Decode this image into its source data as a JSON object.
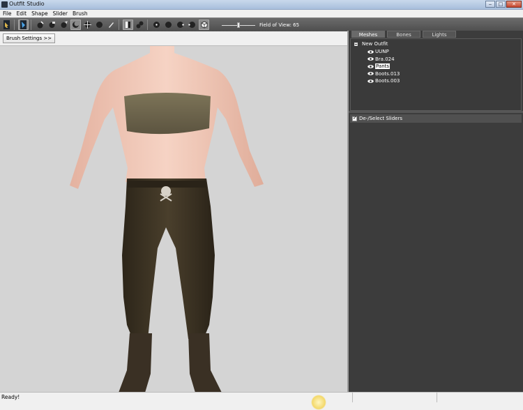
{
  "window": {
    "title": "Outfit Studio"
  },
  "menu": [
    "File",
    "Edit",
    "Shape",
    "Slider",
    "Brush"
  ],
  "toolbar": {
    "tools": [
      {
        "name": "select-tool-icon",
        "active": false
      },
      {
        "name": "mask-brush-icon",
        "active": true
      },
      {
        "name": "inflate-brush-icon",
        "active": false
      },
      {
        "name": "deflate-brush-icon",
        "active": false
      },
      {
        "name": "move-brush-icon",
        "active": false
      },
      {
        "name": "smooth-brush-icon",
        "active": true
      },
      {
        "name": "transform-icon",
        "active": false
      },
      {
        "name": "undiff-brush-icon",
        "active": false
      },
      {
        "name": "weight-brush-icon",
        "active": false
      }
    ],
    "fov_label": "Field of View: 65",
    "fov_value": 65
  },
  "brush_settings_label": "Brush Settings >>",
  "panel": {
    "tabs": [
      {
        "label": "Meshes",
        "active": true
      },
      {
        "label": "Bones",
        "active": false
      },
      {
        "label": "Lights",
        "active": false
      }
    ],
    "tree_root": "New Outfit",
    "meshes": [
      {
        "label": "UUNP",
        "selected": false
      },
      {
        "label": "Bra.024",
        "selected": false
      },
      {
        "label": "Pants",
        "selected": true
      },
      {
        "label": "Boots.013",
        "selected": false
      },
      {
        "label": "Boots.003",
        "selected": false
      }
    ],
    "sliders_header": "De-/Select Sliders"
  },
  "status": {
    "text": "Ready!"
  },
  "colors": {
    "viewport_bg": "#d4d4d4",
    "panel_bg": "#3c3c3c",
    "toolbar_bg": "#555555"
  }
}
